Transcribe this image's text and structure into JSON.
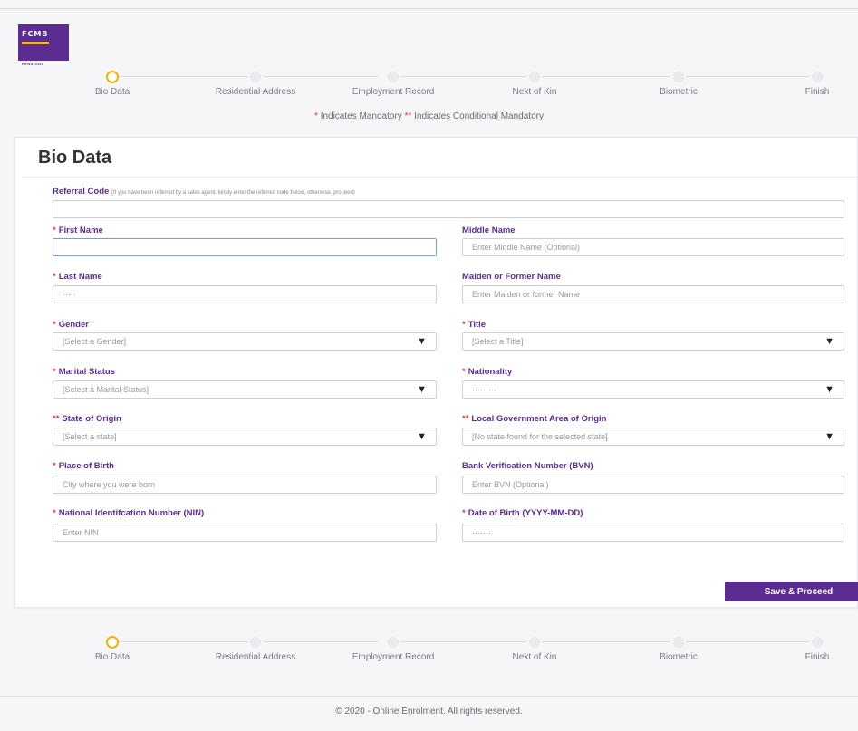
{
  "brand": {
    "name": "FCMB",
    "subtitle": "PENSIONS"
  },
  "steps": [
    "Bio Data",
    "Residential Address",
    "Employment Record",
    "Next of Kin",
    "Biometric",
    "Finish"
  ],
  "mandatory_note": {
    "single_star": "*",
    "single_text": "Indicates Mandatory",
    "double_star": "**",
    "double_text": "Indicates Conditional Mandatory"
  },
  "form": {
    "title": "Bio Data",
    "referral": {
      "label": "Referral Code",
      "hint": "(If you have been referred by a sales agent, kindly enter the referred code below, otherwise, proceed)",
      "value": ""
    },
    "first_name": {
      "req": "*",
      "label": "First Name",
      "placeholder": ""
    },
    "middle_name": {
      "label": "Middle Name",
      "placeholder": "Enter Middle Name (Optional)"
    },
    "last_name": {
      "req": "*",
      "label": "Last Name",
      "placeholder": "·····"
    },
    "maiden_name": {
      "label": "Maiden or Former Name",
      "placeholder": "Enter Maiden or former Name"
    },
    "gender": {
      "req": "*",
      "label": "Gender",
      "value": "[Select a Gender]"
    },
    "title_field": {
      "req": "*",
      "label": "Title",
      "value": "[Select a Title]"
    },
    "marital_status": {
      "req": "*",
      "label": "Marital Status",
      "value": "[Select a Marital Status]"
    },
    "nationality": {
      "req": "*",
      "label": "Nationality",
      "value": "·········"
    },
    "state_of_origin": {
      "req": "**",
      "label": "State of Origin",
      "value": "[Select a state]"
    },
    "lga_of_origin": {
      "req": "**",
      "label": "Local Government Area of Origin",
      "value": "[No state found for the selected state]"
    },
    "place_of_birth": {
      "req": "*",
      "label": "Place of Birth",
      "placeholder": "City where you were born"
    },
    "bvn": {
      "label": "Bank Verification Number (BVN)",
      "placeholder": "Enter BVN (Optional)"
    },
    "nin": {
      "req": "*",
      "label": "National Identifcation Number (NIN)",
      "placeholder": "Enter NIN"
    },
    "dob": {
      "req": "*",
      "label": "Date of Birth (YYYY-MM-DD)",
      "placeholder": "·······"
    },
    "save_label": "Save & Proceed"
  },
  "footer": "© 2020 - Online Enrolment. All rights reserved.",
  "colors": {
    "primary": "#5c2d91",
    "accent": "#f5b400",
    "required": "#e03a3a"
  },
  "icons": {
    "dropdown": "caret-down-icon",
    "active_step": "circle-outline-icon",
    "inactive_step": "circle-filled-icon"
  }
}
